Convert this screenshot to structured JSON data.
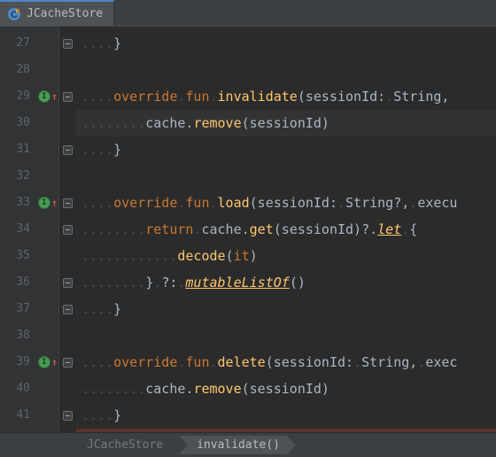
{
  "tab": {
    "label": "JCacheStore"
  },
  "gutter": [
    "27",
    "28",
    "29",
    "30",
    "31",
    "32",
    "33",
    "34",
    "35",
    "36",
    "37",
    "38",
    "39",
    "40",
    "41"
  ],
  "code": {
    "l27": {
      "ws": "....",
      "brace": "}"
    },
    "l28": {
      "ws": ""
    },
    "l29": {
      "ws": "....",
      "kw1": "override",
      "kw2": "fun",
      "fn": "invalidate",
      "args": "(sessionId:",
      "type": "String",
      "tail": ","
    },
    "l30": {
      "ws": "........",
      "obj": "cache",
      "m": "remove",
      "args": "(sessionId)"
    },
    "l31": {
      "ws": "....",
      "brace": "}"
    },
    "l32": {
      "ws": ""
    },
    "l33": {
      "ws": "....",
      "kw1": "override",
      "kw2": "fun",
      "fn": "load",
      "args": "(sessionId:",
      "type": "String?",
      "tail": ",",
      "exec": "execu"
    },
    "l34": {
      "ws": "........",
      "kw": "return",
      "obj": "cache",
      "m": "get",
      "args": "(sessionId)?",
      "let": "let",
      "brace": "{"
    },
    "l35": {
      "ws": "............",
      "fn": "decode",
      "arg": "it",
      "close": ")"
    },
    "l36": {
      "ws": "........",
      "brace": "}",
      "q": "?:",
      "fn": "mutableListOf",
      "close": "()"
    },
    "l37": {
      "ws": "....",
      "brace": "}"
    },
    "l38": {
      "ws": ""
    },
    "l39": {
      "ws": "....",
      "kw1": "override",
      "kw2": "fun",
      "fn": "delete",
      "args": "(sessionId:",
      "type": "String",
      "tail": ",",
      "exec": "exec"
    },
    "l40": {
      "ws": "........",
      "obj": "cache",
      "m": "remove",
      "args": "(sessionId)"
    },
    "l41": {
      "ws": "....",
      "brace": "}"
    }
  },
  "breadcrumb": {
    "file": "JCacheStore",
    "method": "invalidate()"
  }
}
